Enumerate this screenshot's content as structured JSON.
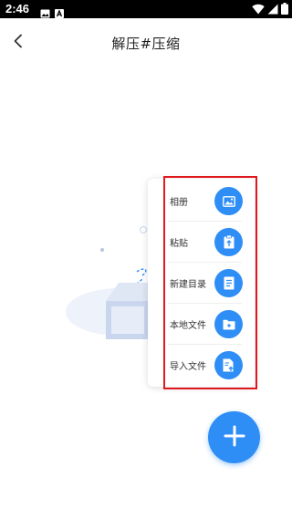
{
  "status_bar": {
    "time": "2:46",
    "notifications": [
      "image-icon",
      "app-icon"
    ],
    "indicators": [
      "wifi-icon",
      "signal-icon",
      "battery-icon"
    ]
  },
  "header": {
    "title": "解压#压缩",
    "back_icon": "chevron-left-icon"
  },
  "popup_menu": {
    "items": [
      {
        "label": "相册",
        "icon": "image-icon"
      },
      {
        "label": "粘贴",
        "icon": "paste-icon"
      },
      {
        "label": "新建目录",
        "icon": "document-icon"
      },
      {
        "label": "本地文件",
        "icon": "folder-icon"
      },
      {
        "label": "导入文件",
        "icon": "import-file-icon"
      }
    ]
  },
  "fab": {
    "icon": "plus-icon"
  },
  "colors": {
    "accent": "#2f8ef5",
    "highlight_frame": "#e0191f",
    "status_bar": "#000000"
  }
}
